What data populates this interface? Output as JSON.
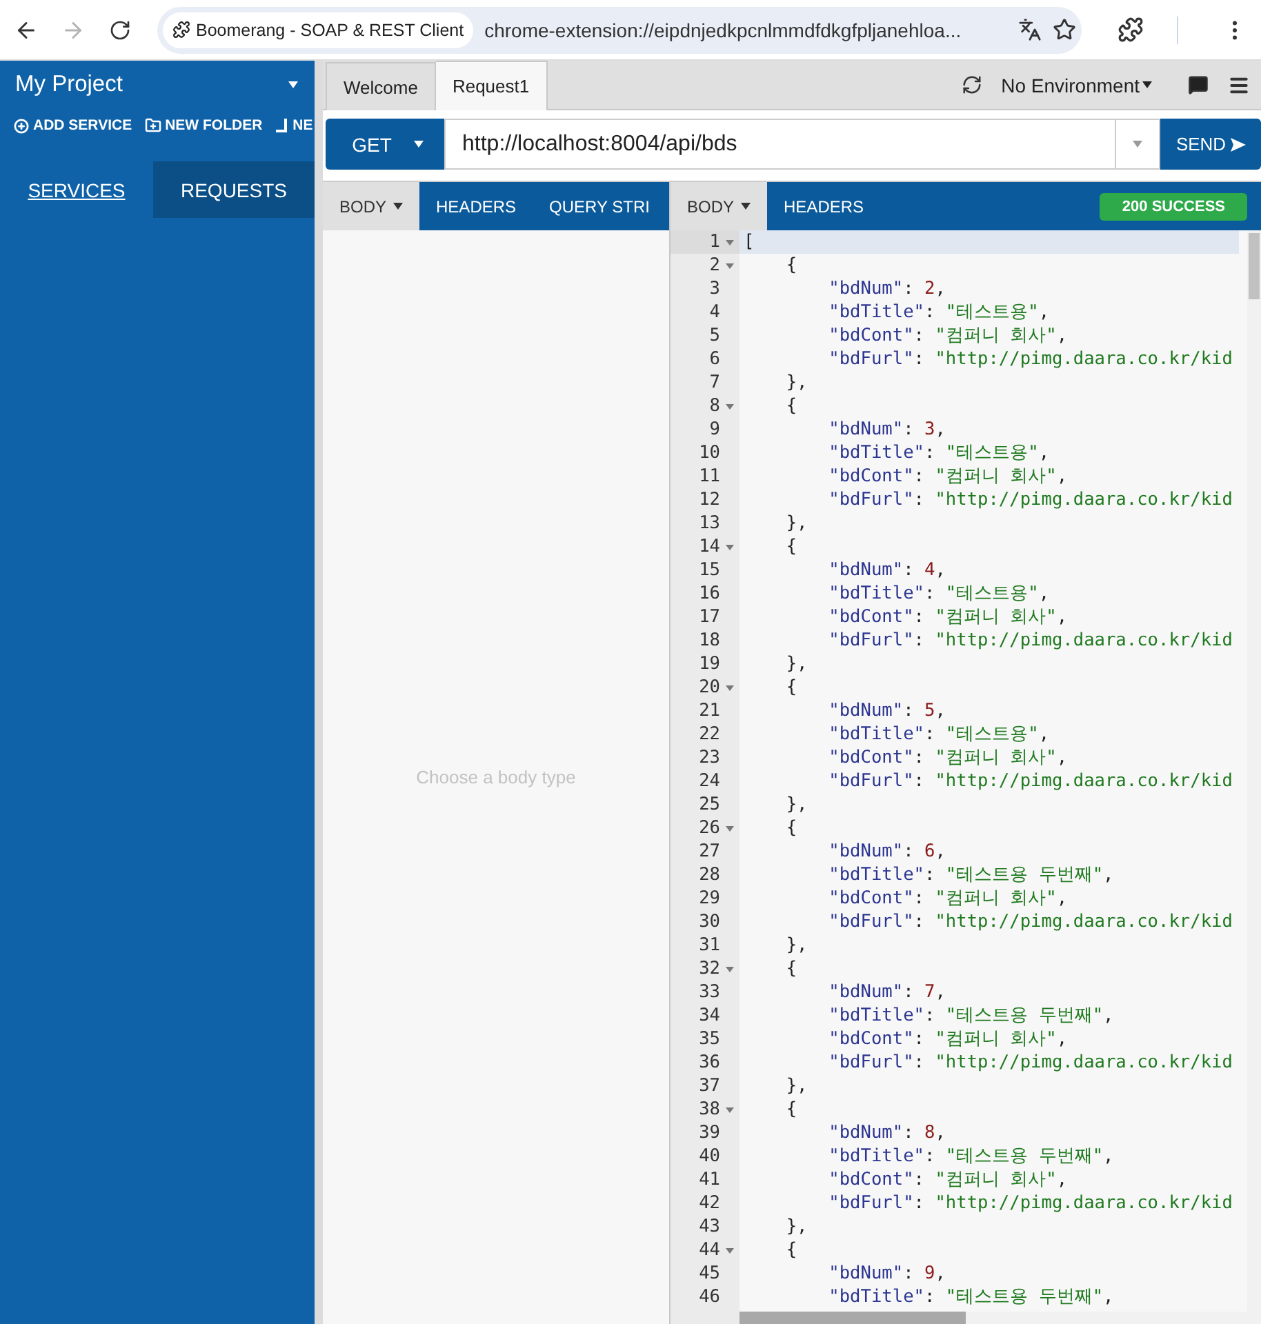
{
  "browser": {
    "nav": [
      {
        "kind": "back",
        "disabled": false
      },
      {
        "kind": "forward",
        "disabled": true
      },
      {
        "kind": "reload",
        "disabled": false
      }
    ],
    "site_chip": "Boomerang - SOAP & REST Client",
    "address": "chrome-extension://eipdnjedkpcnlmmdfdkgfpljanehloa..."
  },
  "sidebar": {
    "project_title": "My Project",
    "actions": [
      {
        "kind": "add",
        "label": "ADD SERVICE"
      },
      {
        "kind": "folder",
        "label": "NEW FOLDER"
      },
      {
        "kind": "new",
        "label": "NE"
      }
    ],
    "tabs": [
      {
        "label": "SERVICES",
        "selected": true
      },
      {
        "label": "REQUESTS",
        "selected": false
      }
    ]
  },
  "request_tabs": [
    {
      "label": "Welcome",
      "selected": false
    },
    {
      "label": "Request1",
      "selected": true
    }
  ],
  "environment": "No Environment",
  "request": {
    "method": "GET",
    "url": "http://localhost:8004/api/bds",
    "send": "SEND"
  },
  "request_panel": {
    "tabs": [
      {
        "label": "BODY",
        "selected": true,
        "dropdown": true
      },
      {
        "label": "HEADERS",
        "selected": false,
        "dropdown": false
      },
      {
        "label": "QUERY STRI",
        "selected": false,
        "dropdown": false
      }
    ],
    "placeholder": "Choose a body type"
  },
  "response_panel": {
    "tabs": [
      {
        "label": "BODY",
        "selected": true,
        "dropdown": true
      },
      {
        "label": "HEADERS",
        "selected": false,
        "dropdown": false
      }
    ],
    "status": "200 SUCCESS",
    "lines": [
      {
        "num": "1",
        "fold": true,
        "active": true,
        "tokens": [
          {
            "kind": "punct",
            "text": "["
          }
        ]
      },
      {
        "num": "2",
        "fold": true,
        "active": false,
        "tokens": [
          {
            "kind": "punct",
            "text": "    {"
          }
        ]
      },
      {
        "num": "3",
        "fold": false,
        "active": false,
        "tokens": [
          {
            "kind": "key",
            "text": "        \"bdNum\""
          },
          {
            "kind": "punct",
            "text": ": "
          },
          {
            "kind": "number",
            "text": "2"
          },
          {
            "kind": "punct",
            "text": ","
          }
        ]
      },
      {
        "num": "4",
        "fold": false,
        "active": false,
        "tokens": [
          {
            "kind": "key",
            "text": "        \"bdTitle\""
          },
          {
            "kind": "punct",
            "text": ": "
          },
          {
            "kind": "string",
            "text": "\"테스트용\""
          },
          {
            "kind": "punct",
            "text": ","
          }
        ]
      },
      {
        "num": "5",
        "fold": false,
        "active": false,
        "tokens": [
          {
            "kind": "key",
            "text": "        \"bdCont\""
          },
          {
            "kind": "punct",
            "text": ": "
          },
          {
            "kind": "string",
            "text": "\"컴퍼니 회사\""
          },
          {
            "kind": "punct",
            "text": ","
          }
        ]
      },
      {
        "num": "6",
        "fold": false,
        "active": false,
        "tokens": [
          {
            "kind": "key",
            "text": "        \"bdFurl\""
          },
          {
            "kind": "punct",
            "text": ": "
          },
          {
            "kind": "string",
            "text": "\"http://pimg.daara.co.kr/kid"
          }
        ]
      },
      {
        "num": "7",
        "fold": false,
        "active": false,
        "tokens": [
          {
            "kind": "punct",
            "text": "    },"
          }
        ]
      },
      {
        "num": "8",
        "fold": true,
        "active": false,
        "tokens": [
          {
            "kind": "punct",
            "text": "    {"
          }
        ]
      },
      {
        "num": "9",
        "fold": false,
        "active": false,
        "tokens": [
          {
            "kind": "key",
            "text": "        \"bdNum\""
          },
          {
            "kind": "punct",
            "text": ": "
          },
          {
            "kind": "number",
            "text": "3"
          },
          {
            "kind": "punct",
            "text": ","
          }
        ]
      },
      {
        "num": "10",
        "fold": false,
        "active": false,
        "tokens": [
          {
            "kind": "key",
            "text": "        \"bdTitle\""
          },
          {
            "kind": "punct",
            "text": ": "
          },
          {
            "kind": "string",
            "text": "\"테스트용\""
          },
          {
            "kind": "punct",
            "text": ","
          }
        ]
      },
      {
        "num": "11",
        "fold": false,
        "active": false,
        "tokens": [
          {
            "kind": "key",
            "text": "        \"bdCont\""
          },
          {
            "kind": "punct",
            "text": ": "
          },
          {
            "kind": "string",
            "text": "\"컴퍼니 회사\""
          },
          {
            "kind": "punct",
            "text": ","
          }
        ]
      },
      {
        "num": "12",
        "fold": false,
        "active": false,
        "tokens": [
          {
            "kind": "key",
            "text": "        \"bdFurl\""
          },
          {
            "kind": "punct",
            "text": ": "
          },
          {
            "kind": "string",
            "text": "\"http://pimg.daara.co.kr/kid"
          }
        ]
      },
      {
        "num": "13",
        "fold": false,
        "active": false,
        "tokens": [
          {
            "kind": "punct",
            "text": "    },"
          }
        ]
      },
      {
        "num": "14",
        "fold": true,
        "active": false,
        "tokens": [
          {
            "kind": "punct",
            "text": "    {"
          }
        ]
      },
      {
        "num": "15",
        "fold": false,
        "active": false,
        "tokens": [
          {
            "kind": "key",
            "text": "        \"bdNum\""
          },
          {
            "kind": "punct",
            "text": ": "
          },
          {
            "kind": "number",
            "text": "4"
          },
          {
            "kind": "punct",
            "text": ","
          }
        ]
      },
      {
        "num": "16",
        "fold": false,
        "active": false,
        "tokens": [
          {
            "kind": "key",
            "text": "        \"bdTitle\""
          },
          {
            "kind": "punct",
            "text": ": "
          },
          {
            "kind": "string",
            "text": "\"테스트용\""
          },
          {
            "kind": "punct",
            "text": ","
          }
        ]
      },
      {
        "num": "17",
        "fold": false,
        "active": false,
        "tokens": [
          {
            "kind": "key",
            "text": "        \"bdCont\""
          },
          {
            "kind": "punct",
            "text": ": "
          },
          {
            "kind": "string",
            "text": "\"컴퍼니 회사\""
          },
          {
            "kind": "punct",
            "text": ","
          }
        ]
      },
      {
        "num": "18",
        "fold": false,
        "active": false,
        "tokens": [
          {
            "kind": "key",
            "text": "        \"bdFurl\""
          },
          {
            "kind": "punct",
            "text": ": "
          },
          {
            "kind": "string",
            "text": "\"http://pimg.daara.co.kr/kid"
          }
        ]
      },
      {
        "num": "19",
        "fold": false,
        "active": false,
        "tokens": [
          {
            "kind": "punct",
            "text": "    },"
          }
        ]
      },
      {
        "num": "20",
        "fold": true,
        "active": false,
        "tokens": [
          {
            "kind": "punct",
            "text": "    {"
          }
        ]
      },
      {
        "num": "21",
        "fold": false,
        "active": false,
        "tokens": [
          {
            "kind": "key",
            "text": "        \"bdNum\""
          },
          {
            "kind": "punct",
            "text": ": "
          },
          {
            "kind": "number",
            "text": "5"
          },
          {
            "kind": "punct",
            "text": ","
          }
        ]
      },
      {
        "num": "22",
        "fold": false,
        "active": false,
        "tokens": [
          {
            "kind": "key",
            "text": "        \"bdTitle\""
          },
          {
            "kind": "punct",
            "text": ": "
          },
          {
            "kind": "string",
            "text": "\"테스트용\""
          },
          {
            "kind": "punct",
            "text": ","
          }
        ]
      },
      {
        "num": "23",
        "fold": false,
        "active": false,
        "tokens": [
          {
            "kind": "key",
            "text": "        \"bdCont\""
          },
          {
            "kind": "punct",
            "text": ": "
          },
          {
            "kind": "string",
            "text": "\"컴퍼니 회사\""
          },
          {
            "kind": "punct",
            "text": ","
          }
        ]
      },
      {
        "num": "24",
        "fold": false,
        "active": false,
        "tokens": [
          {
            "kind": "key",
            "text": "        \"bdFurl\""
          },
          {
            "kind": "punct",
            "text": ": "
          },
          {
            "kind": "string",
            "text": "\"http://pimg.daara.co.kr/kid"
          }
        ]
      },
      {
        "num": "25",
        "fold": false,
        "active": false,
        "tokens": [
          {
            "kind": "punct",
            "text": "    },"
          }
        ]
      },
      {
        "num": "26",
        "fold": true,
        "active": false,
        "tokens": [
          {
            "kind": "punct",
            "text": "    {"
          }
        ]
      },
      {
        "num": "27",
        "fold": false,
        "active": false,
        "tokens": [
          {
            "kind": "key",
            "text": "        \"bdNum\""
          },
          {
            "kind": "punct",
            "text": ": "
          },
          {
            "kind": "number",
            "text": "6"
          },
          {
            "kind": "punct",
            "text": ","
          }
        ]
      },
      {
        "num": "28",
        "fold": false,
        "active": false,
        "tokens": [
          {
            "kind": "key",
            "text": "        \"bdTitle\""
          },
          {
            "kind": "punct",
            "text": ": "
          },
          {
            "kind": "string",
            "text": "\"테스트용 두번째\""
          },
          {
            "kind": "punct",
            "text": ","
          }
        ]
      },
      {
        "num": "29",
        "fold": false,
        "active": false,
        "tokens": [
          {
            "kind": "key",
            "text": "        \"bdCont\""
          },
          {
            "kind": "punct",
            "text": ": "
          },
          {
            "kind": "string",
            "text": "\"컴퍼니 회사\""
          },
          {
            "kind": "punct",
            "text": ","
          }
        ]
      },
      {
        "num": "30",
        "fold": false,
        "active": false,
        "tokens": [
          {
            "kind": "key",
            "text": "        \"bdFurl\""
          },
          {
            "kind": "punct",
            "text": ": "
          },
          {
            "kind": "string",
            "text": "\"http://pimg.daara.co.kr/kid"
          }
        ]
      },
      {
        "num": "31",
        "fold": false,
        "active": false,
        "tokens": [
          {
            "kind": "punct",
            "text": "    },"
          }
        ]
      },
      {
        "num": "32",
        "fold": true,
        "active": false,
        "tokens": [
          {
            "kind": "punct",
            "text": "    {"
          }
        ]
      },
      {
        "num": "33",
        "fold": false,
        "active": false,
        "tokens": [
          {
            "kind": "key",
            "text": "        \"bdNum\""
          },
          {
            "kind": "punct",
            "text": ": "
          },
          {
            "kind": "number",
            "text": "7"
          },
          {
            "kind": "punct",
            "text": ","
          }
        ]
      },
      {
        "num": "34",
        "fold": false,
        "active": false,
        "tokens": [
          {
            "kind": "key",
            "text": "        \"bdTitle\""
          },
          {
            "kind": "punct",
            "text": ": "
          },
          {
            "kind": "string",
            "text": "\"테스트용 두번째\""
          },
          {
            "kind": "punct",
            "text": ","
          }
        ]
      },
      {
        "num": "35",
        "fold": false,
        "active": false,
        "tokens": [
          {
            "kind": "key",
            "text": "        \"bdCont\""
          },
          {
            "kind": "punct",
            "text": ": "
          },
          {
            "kind": "string",
            "text": "\"컴퍼니 회사\""
          },
          {
            "kind": "punct",
            "text": ","
          }
        ]
      },
      {
        "num": "36",
        "fold": false,
        "active": false,
        "tokens": [
          {
            "kind": "key",
            "text": "        \"bdFurl\""
          },
          {
            "kind": "punct",
            "text": ": "
          },
          {
            "kind": "string",
            "text": "\"http://pimg.daara.co.kr/kid"
          }
        ]
      },
      {
        "num": "37",
        "fold": false,
        "active": false,
        "tokens": [
          {
            "kind": "punct",
            "text": "    },"
          }
        ]
      },
      {
        "num": "38",
        "fold": true,
        "active": false,
        "tokens": [
          {
            "kind": "punct",
            "text": "    {"
          }
        ]
      },
      {
        "num": "39",
        "fold": false,
        "active": false,
        "tokens": [
          {
            "kind": "key",
            "text": "        \"bdNum\""
          },
          {
            "kind": "punct",
            "text": ": "
          },
          {
            "kind": "number",
            "text": "8"
          },
          {
            "kind": "punct",
            "text": ","
          }
        ]
      },
      {
        "num": "40",
        "fold": false,
        "active": false,
        "tokens": [
          {
            "kind": "key",
            "text": "        \"bdTitle\""
          },
          {
            "kind": "punct",
            "text": ": "
          },
          {
            "kind": "string",
            "text": "\"테스트용 두번째\""
          },
          {
            "kind": "punct",
            "text": ","
          }
        ]
      },
      {
        "num": "41",
        "fold": false,
        "active": false,
        "tokens": [
          {
            "kind": "key",
            "text": "        \"bdCont\""
          },
          {
            "kind": "punct",
            "text": ": "
          },
          {
            "kind": "string",
            "text": "\"컴퍼니 회사\""
          },
          {
            "kind": "punct",
            "text": ","
          }
        ]
      },
      {
        "num": "42",
        "fold": false,
        "active": false,
        "tokens": [
          {
            "kind": "key",
            "text": "        \"bdFurl\""
          },
          {
            "kind": "punct",
            "text": ": "
          },
          {
            "kind": "string",
            "text": "\"http://pimg.daara.co.kr/kid"
          }
        ]
      },
      {
        "num": "43",
        "fold": false,
        "active": false,
        "tokens": [
          {
            "kind": "punct",
            "text": "    },"
          }
        ]
      },
      {
        "num": "44",
        "fold": true,
        "active": false,
        "tokens": [
          {
            "kind": "punct",
            "text": "    {"
          }
        ]
      },
      {
        "num": "45",
        "fold": false,
        "active": false,
        "tokens": [
          {
            "kind": "key",
            "text": "        \"bdNum\""
          },
          {
            "kind": "punct",
            "text": ": "
          },
          {
            "kind": "number",
            "text": "9"
          },
          {
            "kind": "punct",
            "text": ","
          }
        ]
      },
      {
        "num": "46",
        "fold": false,
        "active": false,
        "tokens": [
          {
            "kind": "key",
            "text": "        \"bdTitle\""
          },
          {
            "kind": "punct",
            "text": ": "
          },
          {
            "kind": "string",
            "text": "\"테스트용 두번째\""
          },
          {
            "kind": "punct",
            "text": ","
          }
        ]
      }
    ]
  }
}
